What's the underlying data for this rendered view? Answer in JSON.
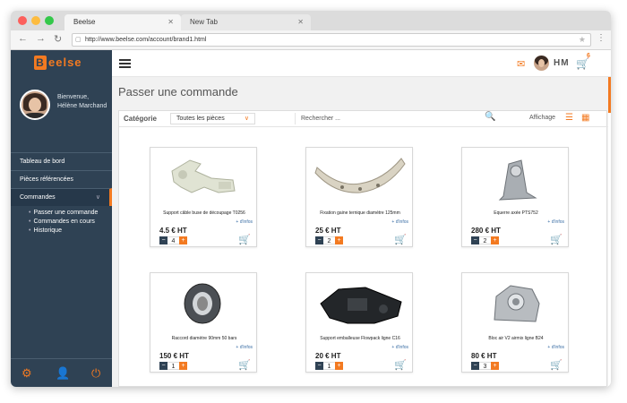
{
  "browser": {
    "tab_active": "Beelse",
    "tab_inactive": "New Tab",
    "url": "http://www.beelse.com/account/brand1.html"
  },
  "sidebar": {
    "logo": "eelse",
    "logo_letter": "B",
    "welcome": "Bienvenue,",
    "user_name": "Hélène Marchand",
    "items": [
      {
        "label": "Tableau de bord"
      },
      {
        "label": "Pièces référencées"
      },
      {
        "label": "Commandes"
      }
    ],
    "sub_items": [
      {
        "label": "Passer une commande"
      },
      {
        "label": "Commandes en cours"
      },
      {
        "label": "Historique"
      }
    ]
  },
  "header": {
    "initials": "HM",
    "cart_count": "6"
  },
  "main": {
    "title": "Passer une commande",
    "category_label": "Catégorie",
    "category_value": "Toutes les pièces",
    "search_placeholder": "Rechercher ...",
    "display_label": "Affichage"
  },
  "products": [
    {
      "name": "Support câble buse de découpage T0256",
      "infos": "+ d'infos",
      "price": "4.5 € HT",
      "qty": "4"
    },
    {
      "name": "Fixation gaine ternique diamètre 125mm",
      "infos": "+ d'infos",
      "price": "25 € HT",
      "qty": "2"
    },
    {
      "name": "Equerre axée PTS752",
      "infos": "+ d'infos",
      "price": "280 € HT",
      "qty": "2"
    },
    {
      "name": "Raccord diamètre 90mm 50 bars",
      "infos": "+ d'infos",
      "price": "150 € HT",
      "qty": "1"
    },
    {
      "name": "Support emballeuse Flowpack ligne C16",
      "infos": "+ d'infos",
      "price": "20 € HT",
      "qty": "1"
    },
    {
      "name": "Bloc air V2 airmix ligne B24",
      "infos": "+ d'infos",
      "price": "80 € HT",
      "qty": "3"
    }
  ],
  "colors": {
    "accent": "#f37a21",
    "sidebar": "#2f4254"
  }
}
